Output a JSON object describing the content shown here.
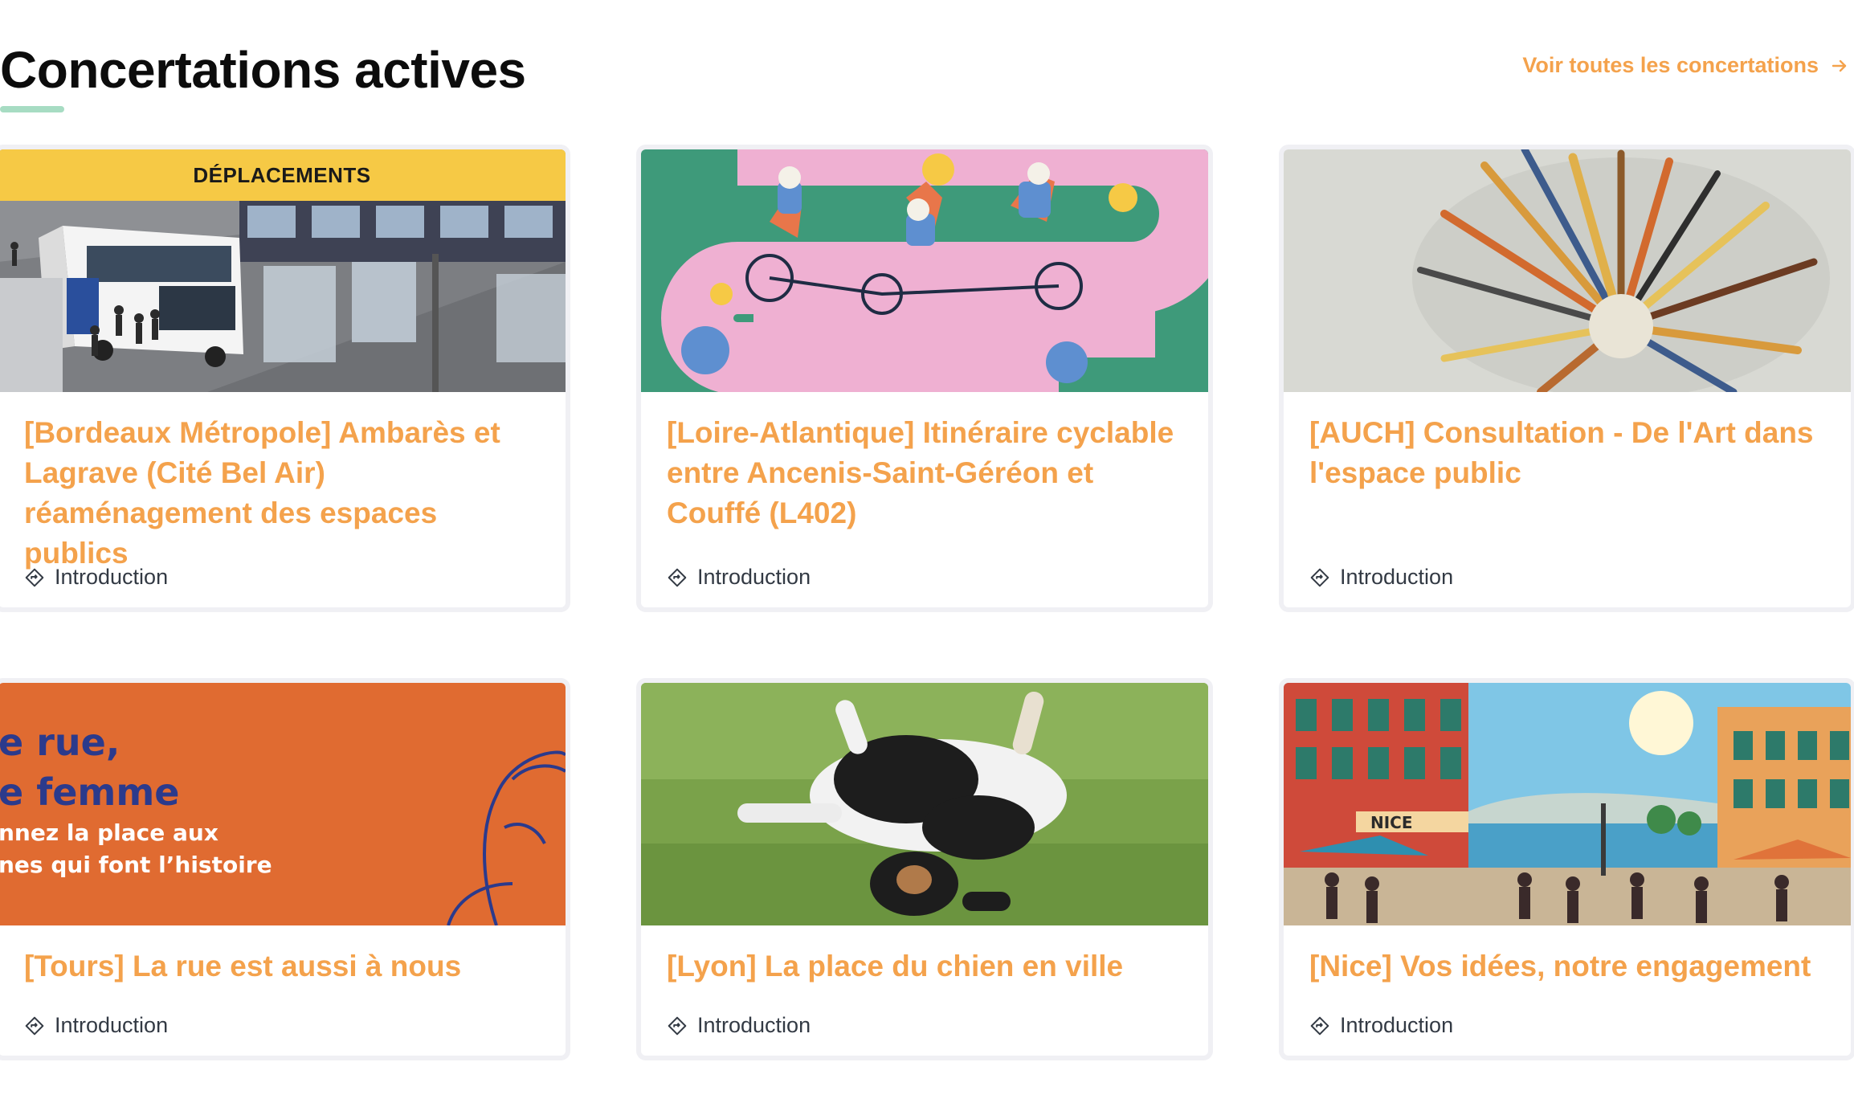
{
  "header": {
    "title": "Concertations actives",
    "see_all_label": "Voir toutes les concertations"
  },
  "cards": [
    {
      "badge": "DÉPLACEMENTS",
      "title": "[Bordeaux Métropole] Ambarès et Lagrave (Cité Bel Air) réaménagement des espaces publics",
      "tag": "Introduction"
    },
    {
      "title": "[Loire-Atlantique] Itinéraire cyclable entre Ancenis-Saint-Géréon et Couffé (L402)",
      "tag": "Introduction"
    },
    {
      "title": "[AUCH] Consultation - De l'Art dans l'espace public",
      "tag": "Introduction"
    },
    {
      "title": "[Tours] La rue est aussi à nous",
      "tag": "Introduction",
      "image_text": [
        "e rue,",
        "e femme",
        "nnez la place aux",
        "nes qui font l’histoire"
      ]
    },
    {
      "title": "[Lyon] La place du chien en ville",
      "tag": "Introduction"
    },
    {
      "title": "[Nice] Vos idées, notre engagement",
      "tag": "Introduction",
      "image_text": [
        "NICE"
      ]
    }
  ],
  "colors": {
    "accent": "#f4a24c",
    "badge": "#f6c945",
    "underline": "#a7dcc3",
    "card_border": "#f0f0f4"
  },
  "icons": {
    "see_all": "arrow-right-icon",
    "tag": "diamond-signpost-icon"
  }
}
